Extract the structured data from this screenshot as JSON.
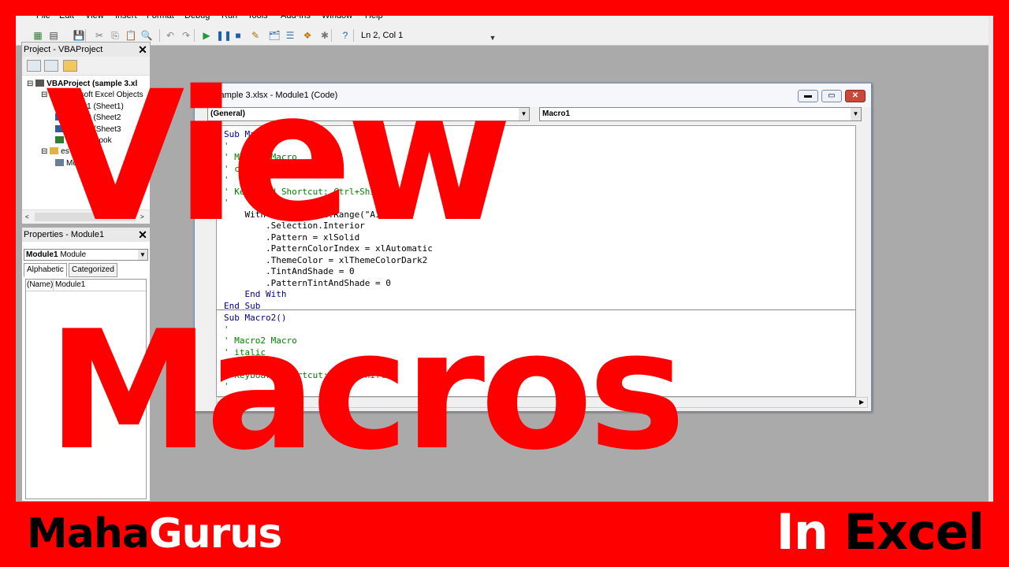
{
  "menu": [
    "File",
    "Edit",
    "View",
    "Insert",
    "Format",
    "Debug",
    "Run",
    "Tools",
    "Add-Ins",
    "Window",
    "Help"
  ],
  "toolbar": {
    "icons": [
      "excel-icon",
      "insert-module-icon",
      "save-icon",
      "cut-icon",
      "copy-icon",
      "paste-icon",
      "find-icon",
      "undo-icon",
      "redo-icon",
      "run-icon",
      "break-icon",
      "reset-icon",
      "design-mode-icon",
      "project-explorer-icon",
      "properties-icon",
      "object-browser-icon",
      "toolbox-icon",
      "help-icon"
    ],
    "position": "Ln 2, Col 1"
  },
  "project_pane": {
    "title": "Project - VBAProject",
    "tree": [
      {
        "label": "VBAProject (sample 3.xl",
        "level": 0,
        "icon": "vbaproject-icon"
      },
      {
        "label": "Microsoft Excel Objects",
        "level": 1,
        "icon": "folder-icon"
      },
      {
        "label": "Sheet1 (Sheet1)",
        "level": 2,
        "icon": "sheet-icon"
      },
      {
        "label": "Sheet2 (Sheet2",
        "level": 2,
        "icon": "sheet-icon"
      },
      {
        "label": "Sheet3 (Sheet3",
        "level": 2,
        "icon": "sheet-icon"
      },
      {
        "label": "hisWorkbook",
        "level": 2,
        "icon": "workbook-icon"
      },
      {
        "label": "es",
        "level": 1,
        "icon": "folder-icon"
      },
      {
        "label": "Module1",
        "level": 2,
        "icon": "module-icon"
      }
    ]
  },
  "properties_pane": {
    "title": "Properties - Module1",
    "object_name": "Module1",
    "object_type": "Module",
    "tabs": [
      "Alphabetic",
      "Categorized"
    ],
    "rows": [
      {
        "name": "(Name)",
        "value": "Module1"
      }
    ]
  },
  "code_window": {
    "title": "sample 3.xlsx - Module1 (Code)",
    "object_combo": "(General)",
    "proc_combo": "Macro1",
    "lines": [
      {
        "text": "Sub Macro1()",
        "kind": "k"
      },
      {
        "text": "'",
        "kind": "c"
      },
      {
        "text": "' Macro1 Macro",
        "kind": "c"
      },
      {
        "text": "' color 2",
        "kind": "c"
      },
      {
        "text": "'",
        "kind": "c"
      },
      {
        "text": "' Keyboard Shortcut: Ctrl+Shift+",
        "kind": "c"
      },
      {
        "text": "'",
        "kind": "c"
      },
      {
        "text": "    With ActiveSheet.Range(\"A1:G14\")",
        "kind": "t"
      },
      {
        "text": "        .Selection.Interior",
        "kind": "t"
      },
      {
        "text": "        .Pattern = xlSolid",
        "kind": "t"
      },
      {
        "text": "        .PatternColorIndex = xlAutomatic",
        "kind": "t"
      },
      {
        "text": "        .ThemeColor = xlThemeColorDark2",
        "kind": "t"
      },
      {
        "text": "        .TintAndShade = 0",
        "kind": "t"
      },
      {
        "text": "        .PatternTintAndShade = 0",
        "kind": "t"
      },
      {
        "text": "    End With",
        "kind": "k"
      },
      {
        "text": "End Sub",
        "kind": "k"
      },
      {
        "text": "Sub Macro2()",
        "kind": "k"
      },
      {
        "text": "'",
        "kind": "c"
      },
      {
        "text": "' Macro2 Macro",
        "kind": "c"
      },
      {
        "text": "' italic",
        "kind": "c"
      },
      {
        "text": "'",
        "kind": "c"
      },
      {
        "text": "' Keyboard Shortcut: Ctrl+Shift+E",
        "kind": "c"
      },
      {
        "text": "'",
        "kind": "c"
      }
    ]
  },
  "overlay": {
    "line1": "View",
    "line2": "Macros"
  },
  "footer": {
    "brand_part1": "Maha",
    "brand_part2": "Gurus",
    "tag_part1": "In",
    "tag_part2": "Excel"
  },
  "colors": {
    "frame": "#ff0000",
    "keyword": "#00008b",
    "comment": "#008000"
  }
}
